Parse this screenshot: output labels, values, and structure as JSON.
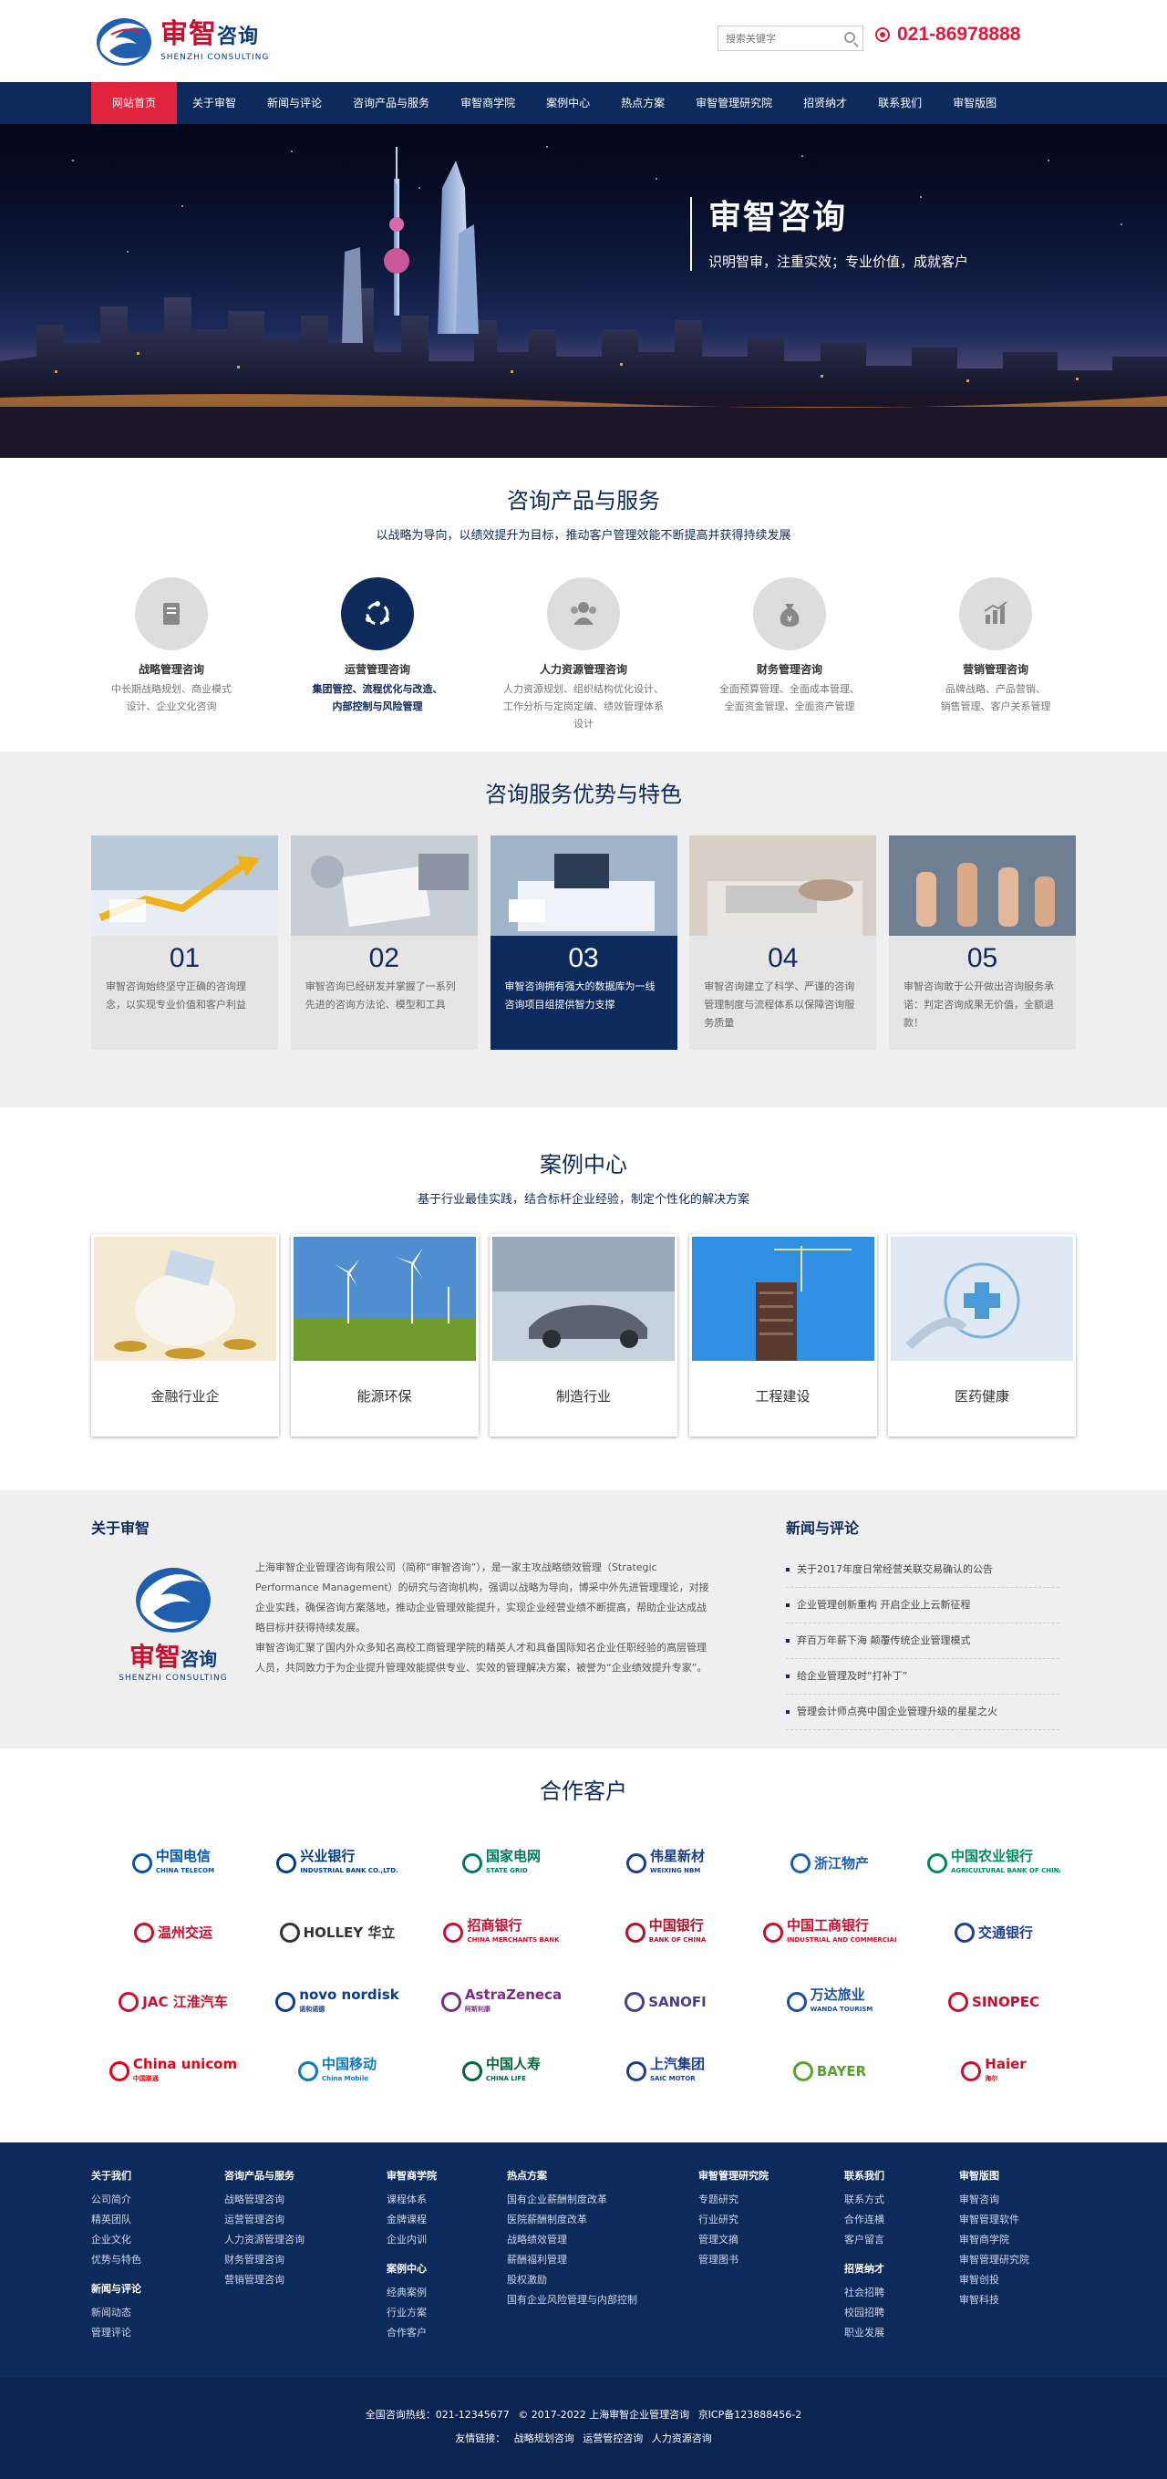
{
  "header": {
    "logo_cn_red": "审智",
    "logo_cn_blue": "咨询",
    "logo_en": "SHENZHI CONSULTING",
    "search_placeholder": "搜索关键字",
    "phone": "021-86978888"
  },
  "nav": [
    "网站首页",
    "关于审智",
    "新闻与评论",
    "咨询产品与服务",
    "审智商学院",
    "案例中心",
    "热点方案",
    "审智管理研究院",
    "招贤纳才",
    "联系我们",
    "审智版图"
  ],
  "banner": {
    "title": "审智咨询",
    "subtitle": "识明智审，注重实效；专业价值，成就客户"
  },
  "services": {
    "title": "咨询产品与服务",
    "subtitle": "以战略为导向，以绩效提升为目标，推动客户管理效能不断提高并获得持续发展",
    "items": [
      {
        "icon": "book-icon",
        "name": "战略管理咨询",
        "desc1": "中长期战略规划、商业模式",
        "desc2": "设计、企业文化咨询"
      },
      {
        "icon": "network-icon",
        "name": "运营管理咨询",
        "desc1": "集团管控、流程优化与改造、",
        "desc2": "内部控制与风险管理"
      },
      {
        "icon": "people-icon",
        "name": "人力资源管理咨询",
        "desc1": "人力资源规划、组织结构优化设计、",
        "desc2": "工作分析与定岗定编、绩效管理体系设计"
      },
      {
        "icon": "money-bag-icon",
        "name": "财务管理咨询",
        "desc1": "全面预算管理、全面成本管理、",
        "desc2": "全面资金管理、全面资产管理"
      },
      {
        "icon": "chart-icon",
        "name": "营销管理咨询",
        "desc1": "品牌战略、产品营销、",
        "desc2": "销售管理、客户关系管理"
      }
    ]
  },
  "advantages": {
    "title": "咨询服务优势与特色",
    "items": [
      {
        "num": "01",
        "text": "审智咨询始终坚守正确的咨询理念，以实现专业价值和客户利益"
      },
      {
        "num": "02",
        "text": "审智咨询已经研发并掌握了一系列先进的咨询方法论、模型和工具"
      },
      {
        "num": "03",
        "text": "审智咨询拥有强大的数据库为一线咨询项目组提供智力支撑"
      },
      {
        "num": "04",
        "text": "审智咨询建立了科学、严谨的咨询管理制度与流程体系以保障咨询服务质量"
      },
      {
        "num": "05",
        "text": "审智咨询敢于公开做出咨询服务承诺：判定咨询成果无价值，全额退款！"
      }
    ]
  },
  "cases": {
    "title": "案例中心",
    "subtitle": "基于行业最佳实践，结合标杆企业经验，制定个性化的解决方案",
    "items": [
      "金融行业企",
      "能源环保",
      "制造行业",
      "工程建设",
      "医药健康"
    ]
  },
  "about": {
    "title": "关于审智",
    "logo_cn_red": "审智",
    "logo_cn_blue": "咨询",
    "logo_en": "SHENZHI CONSULTING",
    "p1": "上海审智企业管理咨询有限公司（简称“审智咨询”），是一家主攻战略绩效管理（Strategic Performance Management）的研究与咨询机构，强调以战略为导向，博采中外先进管理理论，对接企业实践，确保咨询方案落地，推动企业管理效能提升，实现企业经营业绩不断提高，帮助企业达成战略目标并获得持续发展。",
    "p2": "审智咨询汇聚了国内外众多知名高校工商管理学院的精英人才和具备国际知名企业任职经验的高层管理人员，共同致力于为企业提升管理效能提供专业、实效的管理解决方案，被誉为“企业绩效提升专家”。"
  },
  "news": {
    "title": "新闻与评论",
    "items": [
      "关于2017年度日常经营关联交易确认的公告",
      "企业管理创新重构 开启企业上云新征程",
      "弃百万年薪下海 颠覆传统企业管理模式",
      "给企业管理及时“打补丁”",
      "管理会计师点亮中国企业管理升级的星星之火"
    ]
  },
  "clients": {
    "title": "合作客户",
    "logos": [
      {
        "name": "中国电信",
        "sub": "CHINA TELECOM",
        "color": "#0056a6"
      },
      {
        "name": "兴业银行",
        "sub": "INDUSTRIAL BANK CO.,LTD.",
        "color": "#003e8a"
      },
      {
        "name": "国家电网",
        "sub": "STATE GRID",
        "color": "#007a5e"
      },
      {
        "name": "伟星新材",
        "sub": "WEIXING NBM",
        "color": "#1b3d8c"
      },
      {
        "name": "浙江物产",
        "sub": "",
        "color": "#1a5fb4"
      },
      {
        "name": "中国农业银行",
        "sub": "AGRICULTURAL BANK OF CHINA",
        "color": "#008c5a"
      },
      {
        "name": "温州交运",
        "sub": "",
        "color": "#c8102e"
      },
      {
        "name": "HOLLEY 华立",
        "sub": "",
        "color": "#333333"
      },
      {
        "name": "招商银行",
        "sub": "CHINA MERCHANTS BANK",
        "color": "#c8102e"
      },
      {
        "name": "中国银行",
        "sub": "BANK OF CHINA",
        "color": "#b0122b"
      },
      {
        "name": "中国工商银行",
        "sub": "INDUSTRIAL AND COMMERCIAL BANK OF CHINA",
        "color": "#c8102e"
      },
      {
        "name": "交通银行",
        "sub": "",
        "color": "#1d3f8f"
      },
      {
        "name": "JAC 江淮汽车",
        "sub": "",
        "color": "#c8102e"
      },
      {
        "name": "novo nordisk",
        "sub": "诺和诺德",
        "color": "#0a3b8c"
      },
      {
        "name": "AstraZeneca",
        "sub": "阿斯利康",
        "color": "#7b2d83"
      },
      {
        "name": "SANOFI",
        "sub": "",
        "color": "#4a3f8f"
      },
      {
        "name": "万达旅业",
        "sub": "WANDA TOURISM",
        "color": "#1d4f9c"
      },
      {
        "name": "SINOPEC",
        "sub": "",
        "color": "#c8102e"
      },
      {
        "name": "China unicom",
        "sub": "中国联通",
        "color": "#e60012"
      },
      {
        "name": "中国移动",
        "sub": "China Mobile",
        "color": "#0a7bc1"
      },
      {
        "name": "中国人寿",
        "sub": "CHINA LIFE",
        "color": "#00653b"
      },
      {
        "name": "上汽集团",
        "sub": "SAIC MOTOR",
        "color": "#1b3d8c"
      },
      {
        "name": "BAYER",
        "sub": "",
        "color": "#5aa02c"
      },
      {
        "name": "Haier",
        "sub": "海尔",
        "color": "#c8102e"
      }
    ]
  },
  "footer": {
    "cols": [
      {
        "h": "关于我们",
        "items": [
          "公司简介",
          "精英团队",
          "企业文化",
          "优势与特色"
        ],
        "h2": "新闻与评论",
        "items2": [
          "新闻动态",
          "管理评论"
        ]
      },
      {
        "h": "咨询产品与服务",
        "items": [
          "战略管理咨询",
          "运营管理咨询",
          "人力资源管理咨询",
          "财务管理咨询",
          "营销管理咨询"
        ]
      },
      {
        "h": "审智商学院",
        "items": [
          "课程体系",
          "金牌课程",
          "企业内训"
        ],
        "h2": "案例中心",
        "items2": [
          "经典案例",
          "行业方案",
          "合作客户"
        ]
      },
      {
        "h": "热点方案",
        "items": [
          "国有企业薪酬制度改革",
          "医院薪酬制度改革",
          "战略绩效管理",
          "薪酬福利管理",
          "股权激励",
          "国有企业风险管理与内部控制"
        ]
      },
      {
        "h": "审智管理研究院",
        "items": [
          "专题研究",
          "行业研究",
          "管理文摘",
          "管理图书"
        ]
      },
      {
        "h": "联系我们",
        "items": [
          "联系方式",
          "合作连横",
          "客户留言"
        ],
        "h2": "招贤纳才",
        "items2": [
          "社会招聘",
          "校园招聘",
          "职业发展"
        ]
      },
      {
        "h": "审智版图",
        "items": [
          "审智咨询",
          "审智管理软件",
          "审智商学院",
          "审智管理研究院",
          "审智创投",
          "审智科技"
        ]
      }
    ],
    "copy1a": "全国咨询热线：021-12345677",
    "copy1b": "© 2017-2022 上海审智企业管理咨询",
    "copy1c": "京ICP备123888456-2",
    "copy2a": "友情链接：",
    "copy2b": "战略规划咨询",
    "copy2c": "运营管控咨询",
    "copy2d": "人力资源咨询"
  },
  "colors": {
    "navy": "#0d2a5c",
    "red": "#e0243e",
    "phone_red": "#e3163c",
    "light_bg": "#f0eff0"
  }
}
